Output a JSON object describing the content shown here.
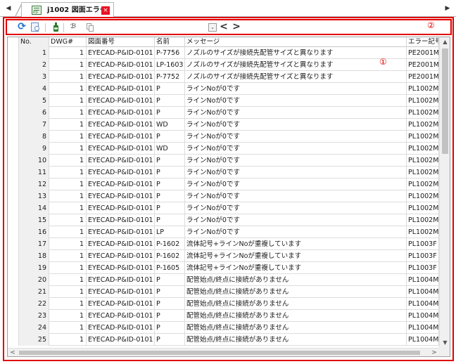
{
  "tab": {
    "label": "j1002 図面エラー",
    "close_glyph": "×",
    "scroll_left_glyph": "◀",
    "scroll_right_glyph": "▶"
  },
  "toolbar": {
    "refresh_glyph": "⟳",
    "find_glyph": "ℬ",
    "dropdown_glyph": "⌄",
    "prev_glyph": "<",
    "next_glyph": ">",
    "marker": "②"
  },
  "grid": {
    "marker": "①",
    "columns": {
      "no": "No.",
      "dwg": "DWG#",
      "drawing": "図面番号",
      "name": "名前",
      "message": "メッセージ",
      "code": "エラー記号"
    },
    "rows": [
      {
        "no": "1",
        "dwg": "1",
        "drawing": "EYECAD-P&ID-0101",
        "name": "P-7756",
        "message": "ノズルのサイズが接続先配管サイズと異なります",
        "code": "PE2001M"
      },
      {
        "no": "2",
        "dwg": "1",
        "drawing": "EYECAD-P&ID-0101",
        "name": "LP-1603",
        "message": "ノズルのサイズが接続先配管サイズと異なります",
        "code": "PE2001M"
      },
      {
        "no": "3",
        "dwg": "1",
        "drawing": "EYECAD-P&ID-0101",
        "name": "P-7752",
        "message": "ノズルのサイズが接続先配管サイズと異なります",
        "code": "PE2001M"
      },
      {
        "no": "4",
        "dwg": "1",
        "drawing": "EYECAD-P&ID-0101",
        "name": "P",
        "message": "ラインNoが0です",
        "code": "PL1002M"
      },
      {
        "no": "5",
        "dwg": "1",
        "drawing": "EYECAD-P&ID-0101",
        "name": "P",
        "message": "ラインNoが0です",
        "code": "PL1002M"
      },
      {
        "no": "6",
        "dwg": "1",
        "drawing": "EYECAD-P&ID-0101",
        "name": "P",
        "message": "ラインNoが0です",
        "code": "PL1002M"
      },
      {
        "no": "7",
        "dwg": "1",
        "drawing": "EYECAD-P&ID-0101",
        "name": "WD",
        "message": "ラインNoが0です",
        "code": "PL1002M"
      },
      {
        "no": "8",
        "dwg": "1",
        "drawing": "EYECAD-P&ID-0101",
        "name": "P",
        "message": "ラインNoが0です",
        "code": "PL1002M"
      },
      {
        "no": "9",
        "dwg": "1",
        "drawing": "EYECAD-P&ID-0101",
        "name": "WD",
        "message": "ラインNoが0です",
        "code": "PL1002M"
      },
      {
        "no": "10",
        "dwg": "1",
        "drawing": "EYECAD-P&ID-0101",
        "name": "P",
        "message": "ラインNoが0です",
        "code": "PL1002M"
      },
      {
        "no": "11",
        "dwg": "1",
        "drawing": "EYECAD-P&ID-0101",
        "name": "P",
        "message": "ラインNoが0です",
        "code": "PL1002M"
      },
      {
        "no": "12",
        "dwg": "1",
        "drawing": "EYECAD-P&ID-0101",
        "name": "P",
        "message": "ラインNoが0です",
        "code": "PL1002M"
      },
      {
        "no": "13",
        "dwg": "1",
        "drawing": "EYECAD-P&ID-0101",
        "name": "P",
        "message": "ラインNoが0です",
        "code": "PL1002M"
      },
      {
        "no": "14",
        "dwg": "1",
        "drawing": "EYECAD-P&ID-0101",
        "name": "P",
        "message": "ラインNoが0です",
        "code": "PL1002M"
      },
      {
        "no": "15",
        "dwg": "1",
        "drawing": "EYECAD-P&ID-0101",
        "name": "P",
        "message": "ラインNoが0です",
        "code": "PL1002M"
      },
      {
        "no": "16",
        "dwg": "1",
        "drawing": "EYECAD-P&ID-0101",
        "name": "LP",
        "message": "ラインNoが0です",
        "code": "PL1002M"
      },
      {
        "no": "17",
        "dwg": "1",
        "drawing": "EYECAD-P&ID-0101",
        "name": "P-1602",
        "message": "流体記号+ラインNoが重複しています",
        "code": "PL1003F"
      },
      {
        "no": "18",
        "dwg": "1",
        "drawing": "EYECAD-P&ID-0101",
        "name": "P-1602",
        "message": "流体記号+ラインNoが重複しています",
        "code": "PL1003F"
      },
      {
        "no": "19",
        "dwg": "1",
        "drawing": "EYECAD-P&ID-0101",
        "name": "P-1605",
        "message": "流体記号+ラインNoが重複しています",
        "code": "PL1003F"
      },
      {
        "no": "20",
        "dwg": "1",
        "drawing": "EYECAD-P&ID-0101",
        "name": "P",
        "message": "配管始点/終点に接続がありません",
        "code": "PL1004M"
      },
      {
        "no": "21",
        "dwg": "1",
        "drawing": "EYECAD-P&ID-0101",
        "name": "P",
        "message": "配管始点/終点に接続がありません",
        "code": "PL1004M"
      },
      {
        "no": "22",
        "dwg": "1",
        "drawing": "EYECAD-P&ID-0101",
        "name": "P",
        "message": "配管始点/終点に接続がありません",
        "code": "PL1004M"
      },
      {
        "no": "23",
        "dwg": "1",
        "drawing": "EYECAD-P&ID-0101",
        "name": "P",
        "message": "配管始点/終点に接続がありません",
        "code": "PL1004M"
      },
      {
        "no": "24",
        "dwg": "1",
        "drawing": "EYECAD-P&ID-0101",
        "name": "P",
        "message": "配管始点/終点に接続がありません",
        "code": "PL1004M"
      },
      {
        "no": "25",
        "dwg": "1",
        "drawing": "EYECAD-P&ID-0101",
        "name": "P",
        "message": "配管始点/終点に接続がありません",
        "code": "PL1004M"
      }
    ]
  },
  "scrollbars": {
    "up_glyph": "▲",
    "down_glyph": "▼",
    "left_glyph": "<",
    "right_glyph": ">"
  },
  "colors": {
    "highlight": "#e00000",
    "refresh": "#1f6fd0",
    "tab_close": "#e81123"
  }
}
